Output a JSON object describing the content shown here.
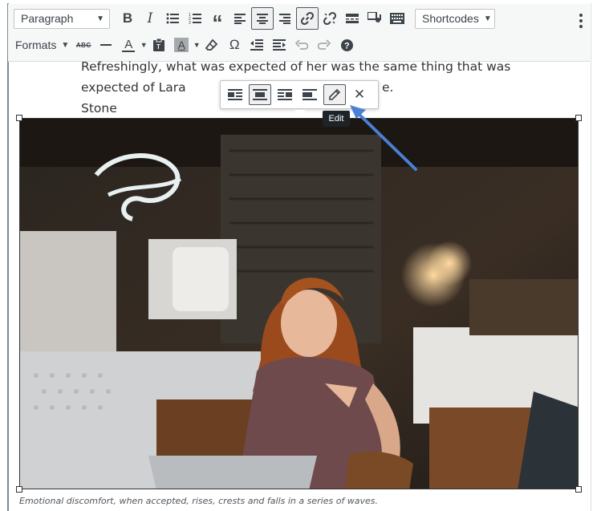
{
  "toolbar": {
    "paragraph_select": "Paragraph",
    "shortcodes_select": "Shortcodes",
    "formats_label": "Formats",
    "strikethrough_label": "ABC",
    "text_color_label": "A",
    "bg_color_label": "A",
    "omega_label": "Ω"
  },
  "content": {
    "paragraph_line1": "Refreshingly, what was expected of her was the same thing that was",
    "paragraph_line2_left": "expected of Lara Stone",
    "paragraph_line2_right": "e."
  },
  "image": {
    "caption": "Emotional discomfort, when accepted, rises, crests and falls in a series of waves."
  },
  "inline_toolbar": {
    "tooltip": "Edit"
  },
  "colors": {
    "accent_arrow": "#4a7fd4",
    "editor_border": "#7e8993",
    "toolbar_bg": "#f6f7f7"
  }
}
